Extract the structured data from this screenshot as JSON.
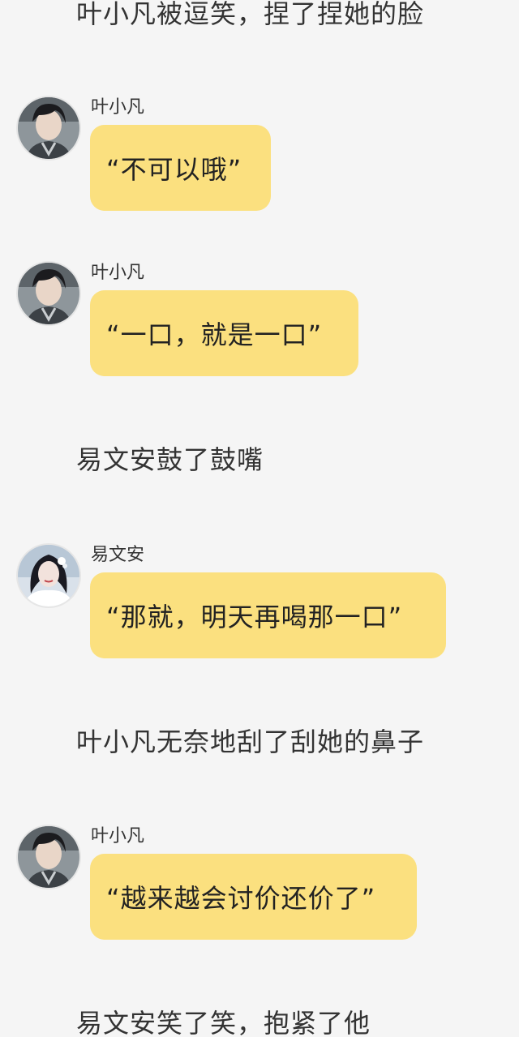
{
  "lines": {
    "n1": "叶小凡被逗笑，捏了捏她的脸",
    "n2": "易文安鼓了鼓嘴",
    "n3": "叶小凡无奈地刮了刮她的鼻子",
    "n4": "易文安笑了笑，抱紧了他"
  },
  "messages": [
    {
      "speaker": "叶小凡",
      "text": "“不可以哦”",
      "avatar": "male-character-avatar"
    },
    {
      "speaker": "叶小凡",
      "text": "“一口，就是一口”",
      "avatar": "male-character-avatar"
    },
    {
      "speaker": "易文安",
      "text": "“那就，明天再喝那一口”",
      "avatar": "female-character-avatar"
    },
    {
      "speaker": "叶小凡",
      "text": "“越来越会讨价还价了”",
      "avatar": "male-character-avatar"
    }
  ],
  "colors": {
    "background": "#f5f5f5",
    "bubble": "#fbe07f",
    "text": "#333333"
  }
}
